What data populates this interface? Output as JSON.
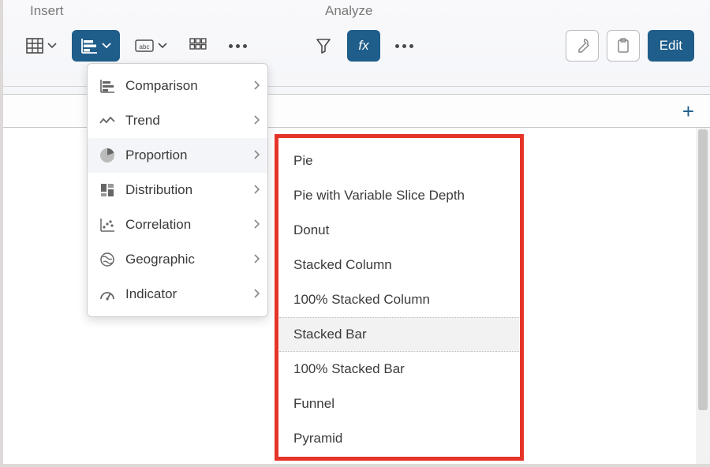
{
  "ribbon": {
    "insert_label": "Insert",
    "analyze_label": "Analyze",
    "edit_label": "Edit"
  },
  "chart_menu": {
    "items": [
      {
        "label": "Comparison"
      },
      {
        "label": "Trend"
      },
      {
        "label": "Proportion"
      },
      {
        "label": "Distribution"
      },
      {
        "label": "Correlation"
      },
      {
        "label": "Geographic"
      },
      {
        "label": "Indicator"
      }
    ],
    "active_index": 2
  },
  "proportion_submenu": {
    "items": [
      "Pie",
      "Pie with Variable Slice Depth",
      "Donut",
      "Stacked Column",
      "100% Stacked Column",
      "Stacked Bar",
      "100% Stacked Bar",
      "Funnel",
      "Pyramid"
    ],
    "hover_index": 5
  }
}
